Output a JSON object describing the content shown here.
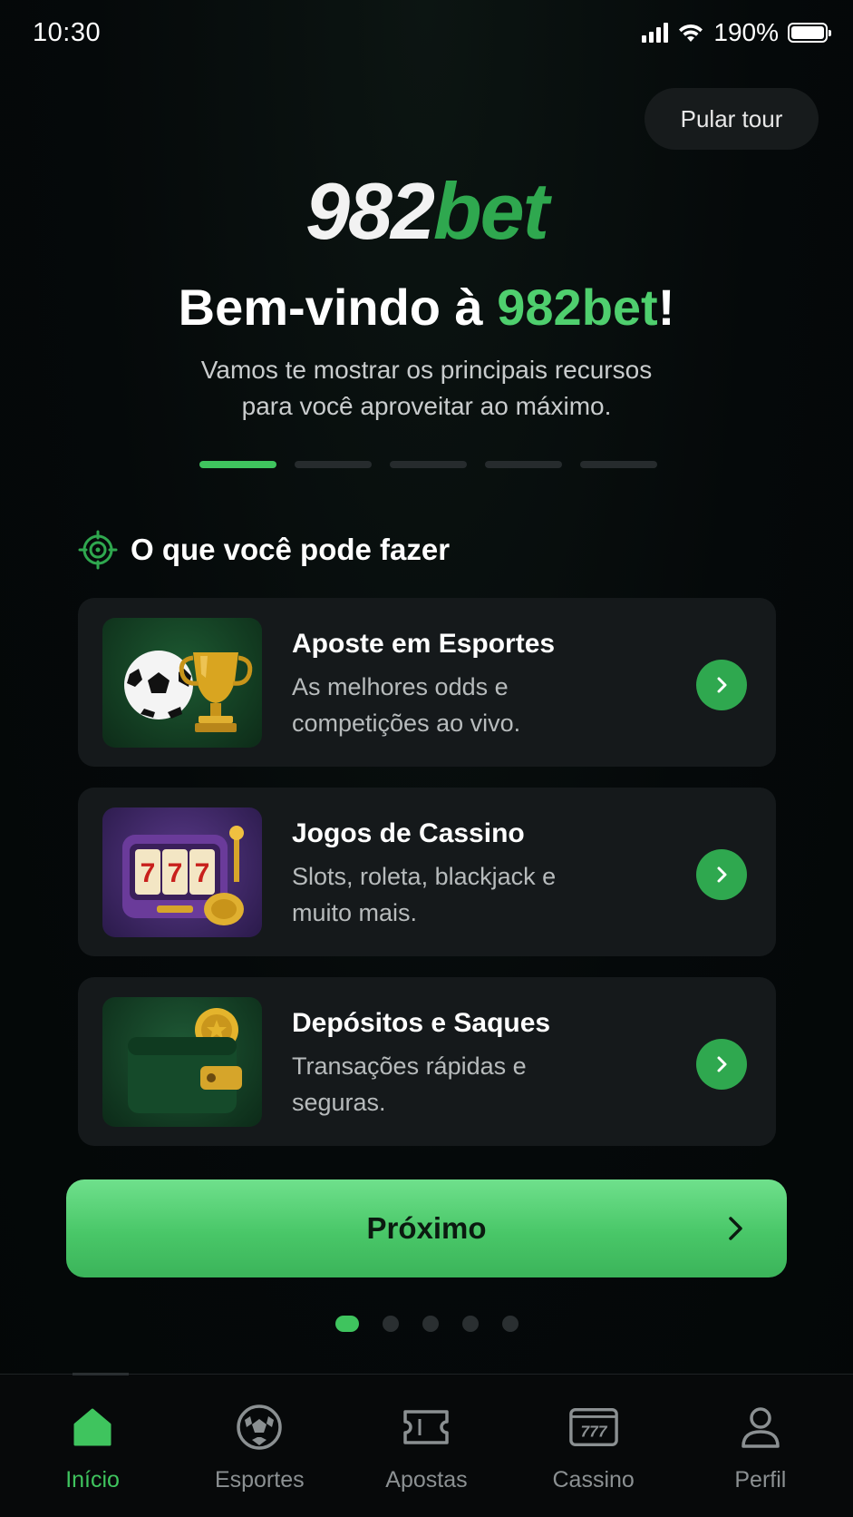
{
  "status_bar": {
    "time": "10:30",
    "battery": "190%"
  },
  "skip_label": "Pular tour",
  "logo": {
    "number": "982",
    "bet": "bet"
  },
  "welcome": {
    "title_prefix": "Bem-vindo à ",
    "title_brand": "982bet",
    "title_suffix": "!",
    "subtitle_line1": "Vamos te mostrar os principais recursos",
    "subtitle_line2": "para você aproveitar ao máximo."
  },
  "progress": {
    "total_steps": 5,
    "current_step": 1
  },
  "section": {
    "title": "O que você pode fazer",
    "icon": "target-icon"
  },
  "features": [
    {
      "title": "Aposte em Esportes",
      "desc_line1": "As melhores odds e",
      "desc_line2": "competições ao vivo.",
      "icon": "soccer-trophy-image"
    },
    {
      "title": "Jogos de Cassino",
      "desc_line1": "Slots, roleta, blackjack e",
      "desc_line2": "muito mais.",
      "icon": "slot-machine-image"
    },
    {
      "title": "Depósitos e Saques",
      "desc_line1": "Transações rápidas e",
      "desc_line2": "seguras.",
      "icon": "wallet-coin-image"
    }
  ],
  "next_button": {
    "label": "Próximo"
  },
  "tabs": [
    {
      "label": "Início",
      "icon": "home-icon",
      "active": true
    },
    {
      "label": "Esportes",
      "icon": "soccer-ball-icon",
      "active": false
    },
    {
      "label": "Apostas",
      "icon": "ticket-icon",
      "active": false
    },
    {
      "label": "Cassino",
      "icon": "slot-777-icon",
      "active": false
    },
    {
      "label": "Perfil",
      "icon": "user-icon",
      "active": false
    }
  ],
  "colors": {
    "accent": "#3fc45e",
    "brand_green": "#2fa84f",
    "background": "#05090a",
    "card": "#15191b"
  }
}
